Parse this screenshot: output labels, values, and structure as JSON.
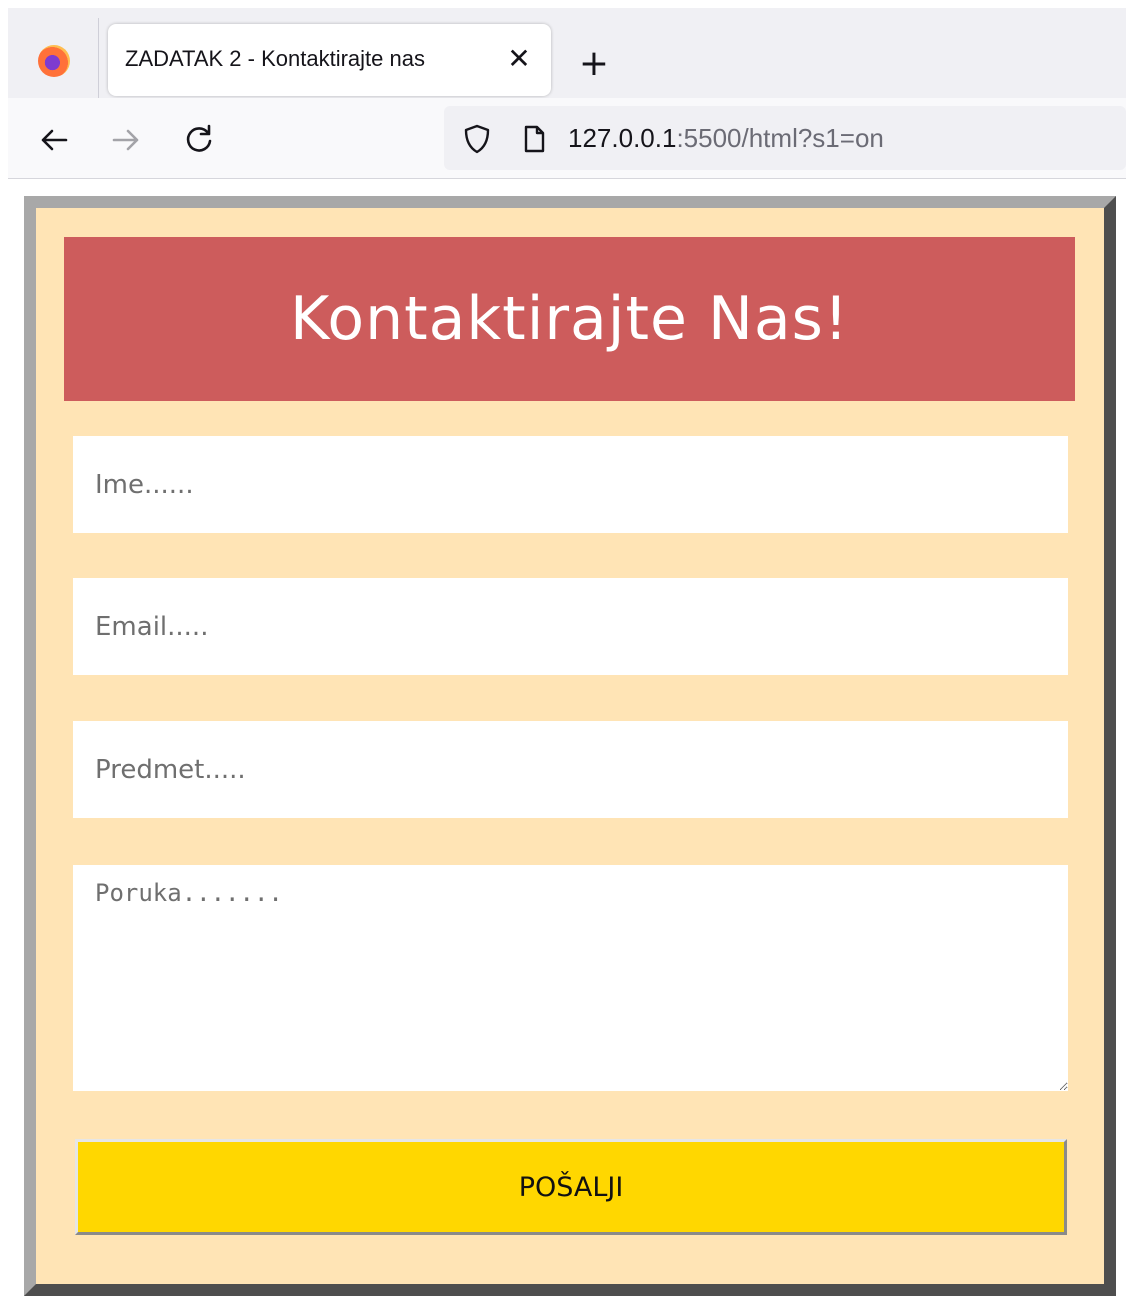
{
  "browser": {
    "tab": {
      "title": "ZADATAK 2 - Kontaktirajte nas",
      "close_glyph": "✕",
      "close_icon": "close-icon"
    },
    "new_tab_glyph": "+",
    "nav": {
      "back_icon": "arrow-left-icon",
      "forward_icon": "arrow-right-icon",
      "reload_icon": "reload-icon"
    },
    "url": {
      "host": "127.0.0.1",
      "rest": ":5500/html?s1=on",
      "shield_icon": "shield-icon",
      "page_icon": "page-icon"
    }
  },
  "form": {
    "heading": "Kontaktirajte Nas!",
    "name_placeholder": "Ime......",
    "email_placeholder": "Email.....",
    "subject_placeholder": "Predmet.....",
    "message_placeholder": "Poruka.......",
    "submit_label": "POŠALJI"
  },
  "colors": {
    "page_background": "#ffe4b5",
    "header_background": "#cd5c5c",
    "submit_background": "#ffd700",
    "frame_light": "#a8a8a8",
    "frame_dark": "#4e4e4e"
  }
}
